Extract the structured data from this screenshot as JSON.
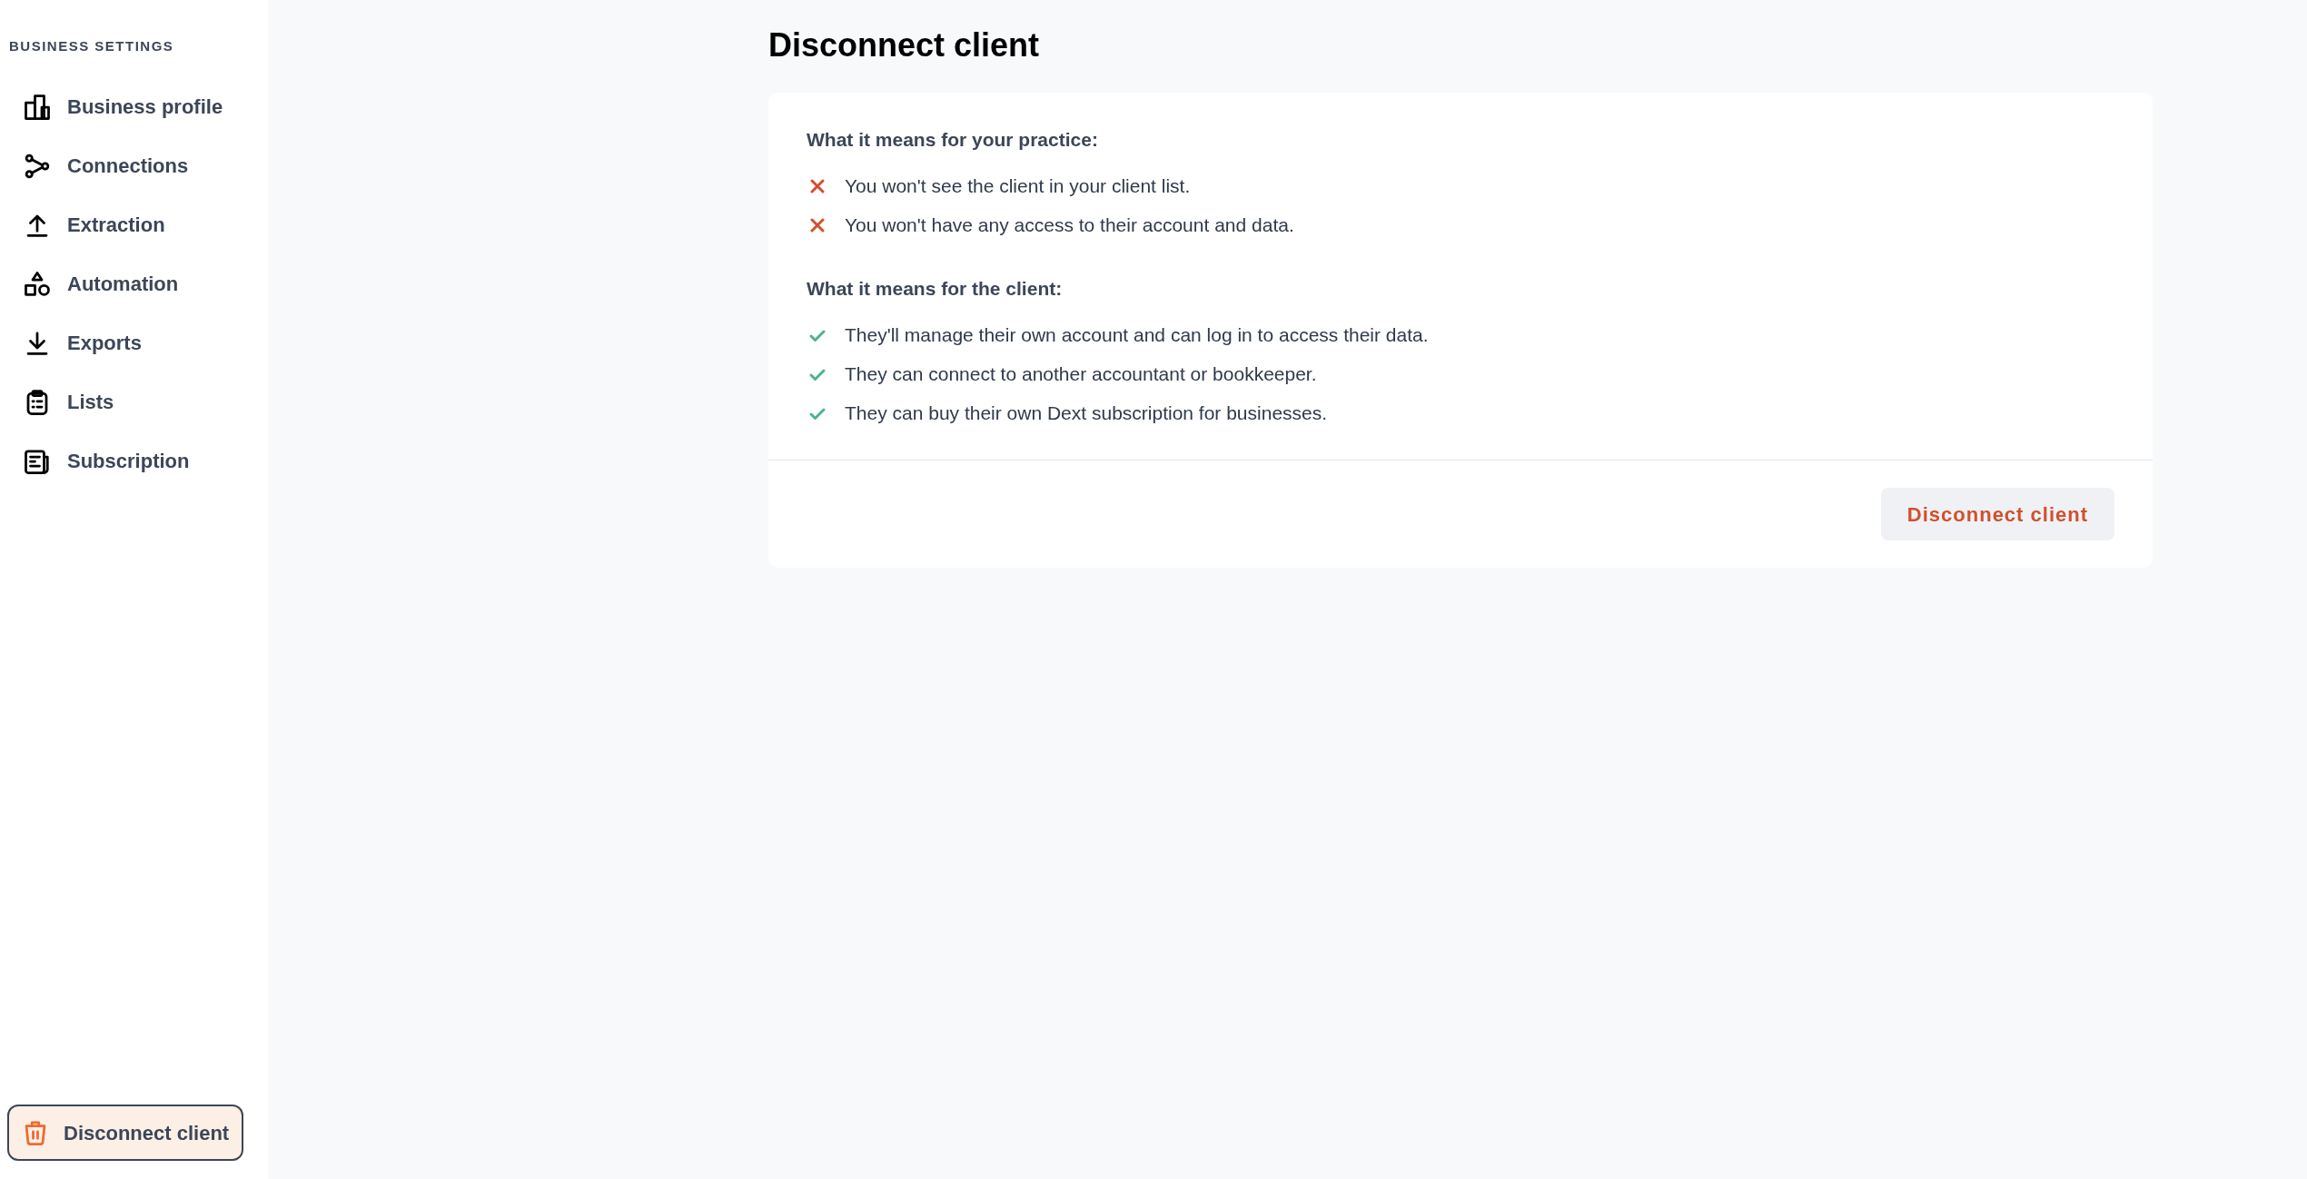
{
  "sidebar": {
    "heading": "BUSINESS SETTINGS",
    "items": [
      {
        "label": "Business profile",
        "selected": false
      },
      {
        "label": "Connections",
        "selected": false
      },
      {
        "label": "Extraction",
        "selected": false
      },
      {
        "label": "Automation",
        "selected": false
      },
      {
        "label": "Exports",
        "selected": false
      },
      {
        "label": "Lists",
        "selected": false
      },
      {
        "label": "Subscription",
        "selected": false
      }
    ],
    "footer_item": {
      "label": "Disconnect client",
      "selected": true
    }
  },
  "page": {
    "title": "Disconnect client",
    "sections": [
      {
        "heading": "What it means for your practice:",
        "points": [
          {
            "kind": "negative",
            "text": "You won't see the client in your client list."
          },
          {
            "kind": "negative",
            "text": "You won't have any access to their account and data."
          }
        ]
      },
      {
        "heading": "What it means for the client:",
        "points": [
          {
            "kind": "positive",
            "text": "They'll manage their own account and can log in to access their data."
          },
          {
            "kind": "positive",
            "text": "They can connect to another accountant or bookkeeper."
          },
          {
            "kind": "positive",
            "text": "They can buy their own Dext subscription for businesses."
          }
        ]
      }
    ],
    "button": "Disconnect client"
  }
}
